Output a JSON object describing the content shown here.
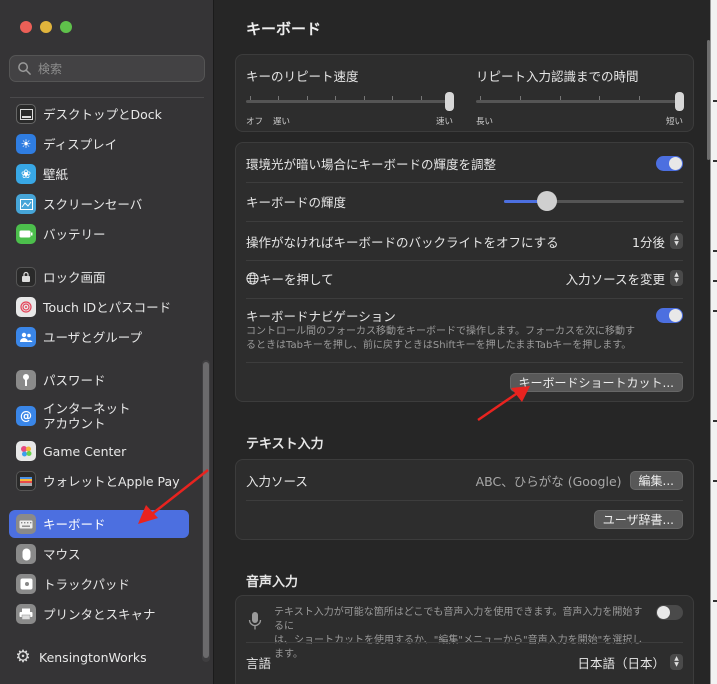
{
  "sidebar": {
    "search_placeholder": "検索",
    "items": [
      {
        "label": "デスクトップとDock",
        "icon": "dock-icon",
        "color": "#2a2a2a"
      },
      {
        "label": "ディスプレイ",
        "icon": "display-icon",
        "color": "#2f7de1"
      },
      {
        "label": "壁紙",
        "icon": "wallpaper-icon",
        "color": "#38a7e5"
      },
      {
        "label": "スクリーンセーバ",
        "icon": "screensaver-icon",
        "color": "#46a5d8"
      },
      {
        "label": "バッテリー",
        "icon": "battery-icon",
        "color": "#4cbf4c"
      },
      {
        "label": "ロック画面",
        "icon": "lock-icon",
        "color": "#2a2a2a"
      },
      {
        "label": "Touch IDとパスコード",
        "icon": "fingerprint-icon",
        "color": "#e8e8e8"
      },
      {
        "label": "ユーザとグループ",
        "icon": "users-icon",
        "color": "#3a86e8"
      },
      {
        "label": "パスワード",
        "icon": "key-icon",
        "color": "#8a8a8a"
      },
      {
        "label": "インターネット\nアカウント",
        "label1": "インターネット",
        "label2": "アカウント",
        "icon": "at-icon",
        "color": "#3a86e8"
      },
      {
        "label": "Game Center",
        "icon": "gamecenter-icon",
        "color": "#e8e8e8"
      },
      {
        "label": "ウォレットとApple Pay",
        "icon": "wallet-icon",
        "color": "#2a2a2a"
      },
      {
        "label": "キーボード",
        "icon": "keyboard-icon",
        "color": "#8a8a8a",
        "selected": true
      },
      {
        "label": "マウス",
        "icon": "mouse-icon",
        "color": "#8a8a8a"
      },
      {
        "label": "トラックパッド",
        "icon": "trackpad-icon",
        "color": "#8a8a8a"
      },
      {
        "label": "プリンタとスキャナ",
        "icon": "printer-icon",
        "color": "#8a8a8a"
      },
      {
        "label": "KensingtonWorks",
        "icon": "gear-icon",
        "color": "transparent"
      }
    ]
  },
  "main": {
    "title": "キーボード",
    "repeat": {
      "rate_label": "キーのリピート速度",
      "rate_left1": "オフ",
      "rate_left2": "遅い",
      "rate_right": "速い",
      "rate_value": 1.0,
      "delay_label": "リピート入力認識までの時間",
      "delay_left": "長い",
      "delay_right": "短い",
      "delay_value": 1.0
    },
    "settings": {
      "ambient_label": "環境光が暗い場合にキーボードの輝度を調整",
      "ambient_on": true,
      "brightness_label": "キーボードの輝度",
      "brightness_value": 0.24,
      "backlight_label": "操作がなければキーボードのバックライトをオフにする",
      "backlight_value": "1分後",
      "globe_label": "キーを押して",
      "globe_value": "入力ソースを変更",
      "nav_label": "キーボードナビゲーション",
      "nav_desc1": "コントロール間のフォーカス移動をキーボードで操作します。フォーカスを次に移動す",
      "nav_desc2": "るときはTabキーを押し、前に戻すときはShiftキーを押したままTabキーを押します。",
      "nav_on": true,
      "shortcuts_button": "キーボードショートカット..."
    },
    "text_input": {
      "header": "テキスト入力",
      "source_label": "入力ソース",
      "source_value": "ABC、ひらがな (Google)",
      "edit_button": "編集...",
      "dict_button": "ユーザ辞書..."
    },
    "dictation": {
      "header": "音声入力",
      "desc1": "テキスト入力が可能な箇所はどこでも音声入力を使用できます。音声入力を開始するに",
      "desc2": "は、ショートカットを使用するか、\"編集\"メニューから\"音声入力を開始\"を選択します。",
      "on": false,
      "language_label": "言語",
      "language_value": "日本語（日本）"
    }
  },
  "colors": {
    "accent": "#4c6fe0",
    "arrow": "#e8231f"
  }
}
